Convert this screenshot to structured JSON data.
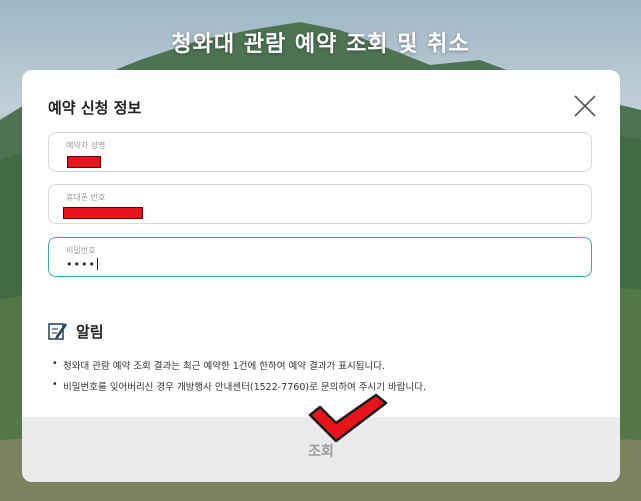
{
  "page": {
    "title": "청와대 관람 예약 조회 및 취소"
  },
  "modal": {
    "title": "예약 신청 정보",
    "fields": {
      "name": {
        "label": "예약자 성명",
        "value": "",
        "redacted": true
      },
      "phone": {
        "label": "휴대폰 번호",
        "value": "",
        "redacted": true
      },
      "password": {
        "label": "비밀번호",
        "value": "••••",
        "focused": true
      }
    },
    "notice": {
      "title": "알림",
      "items": [
        {
          "bullet": "•",
          "text": "청와대 관람 예약 조회 결과는 최근 예약한 1건에 한하여 예약 결과가 표시됩니다."
        },
        {
          "bullet": "•",
          "text": "비밀번호를 잊어버리신 경우 개방행사 안내센터(1522-7760)로 문의하여 주시기 바랍니다."
        }
      ]
    },
    "submit_label": "조회"
  },
  "colors": {
    "focus_border": "#3fa4b8",
    "redaction": "#e8141c",
    "checkmark": "#e8141c",
    "submit_bg": "#ebebeb"
  },
  "icons": {
    "close": "close-icon",
    "notice": "pencil-note-icon",
    "annotation": "checkmark-icon"
  }
}
